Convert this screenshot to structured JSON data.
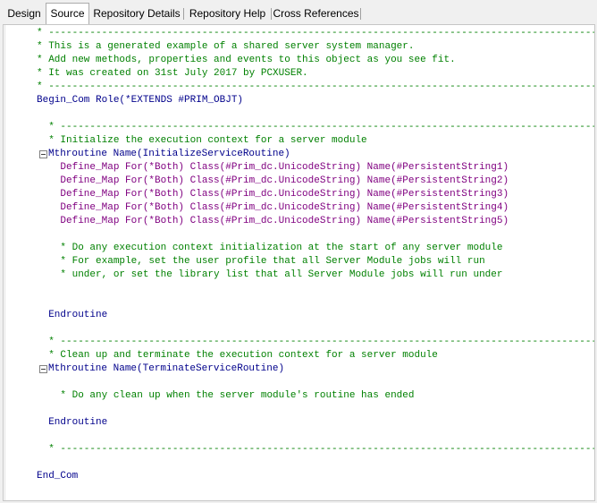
{
  "tabs": [
    {
      "label": "Design",
      "active": false
    },
    {
      "label": "Source",
      "active": true
    },
    {
      "label": "Repository Details",
      "active": false
    },
    {
      "label": "Repository Help",
      "active": false
    },
    {
      "label": "Cross References",
      "active": false
    }
  ],
  "code": {
    "lines": [
      "* -----------------------------------------------------------------------------------------------",
      "* This is a generated example of a shared server system manager.",
      "* Add new methods, properties and events to this object as you see fit.",
      "* It was created on 31st July 2017 by PCXUSER.",
      "* -----------------------------------------------------------------------------------------------",
      "Begin_Com Role(*EXTENDS #PRIM_OBJT)",
      "",
      "  * -----------------------------------------------------------------------------------------------",
      "  * Initialize the execution context for a server module",
      "Mthroutine Name(InitializeServiceRoutine)",
      "    Define_Map For(*Both) Class(#Prim_dc.UnicodeString) Name(#PersistentString1)",
      "    Define_Map For(*Both) Class(#Prim_dc.UnicodeString) Name(#PersistentString2)",
      "    Define_Map For(*Both) Class(#Prim_dc.UnicodeString) Name(#PersistentString3)",
      "    Define_Map For(*Both) Class(#Prim_dc.UnicodeString) Name(#PersistentString4)",
      "    Define_Map For(*Both) Class(#Prim_dc.UnicodeString) Name(#PersistentString5)",
      "",
      "    * Do any execution context initialization at the start of any server module",
      "    * For example, set the user profile that all Server Module jobs will run",
      "    * under, or set the library list that all Server Module jobs will run under",
      "",
      "",
      "  Endroutine",
      "",
      "  * -----------------------------------------------------------------------------------------------",
      "  * Clean up and terminate the execution context for a server module",
      "Mthroutine Name(TerminateServiceRoutine)",
      "",
      "    * Do any clean up when the server module's routine has ended",
      "",
      "  Endroutine",
      "",
      "  * -----------------------------------------------------------------------------------------------",
      "",
      "End_Com"
    ]
  }
}
